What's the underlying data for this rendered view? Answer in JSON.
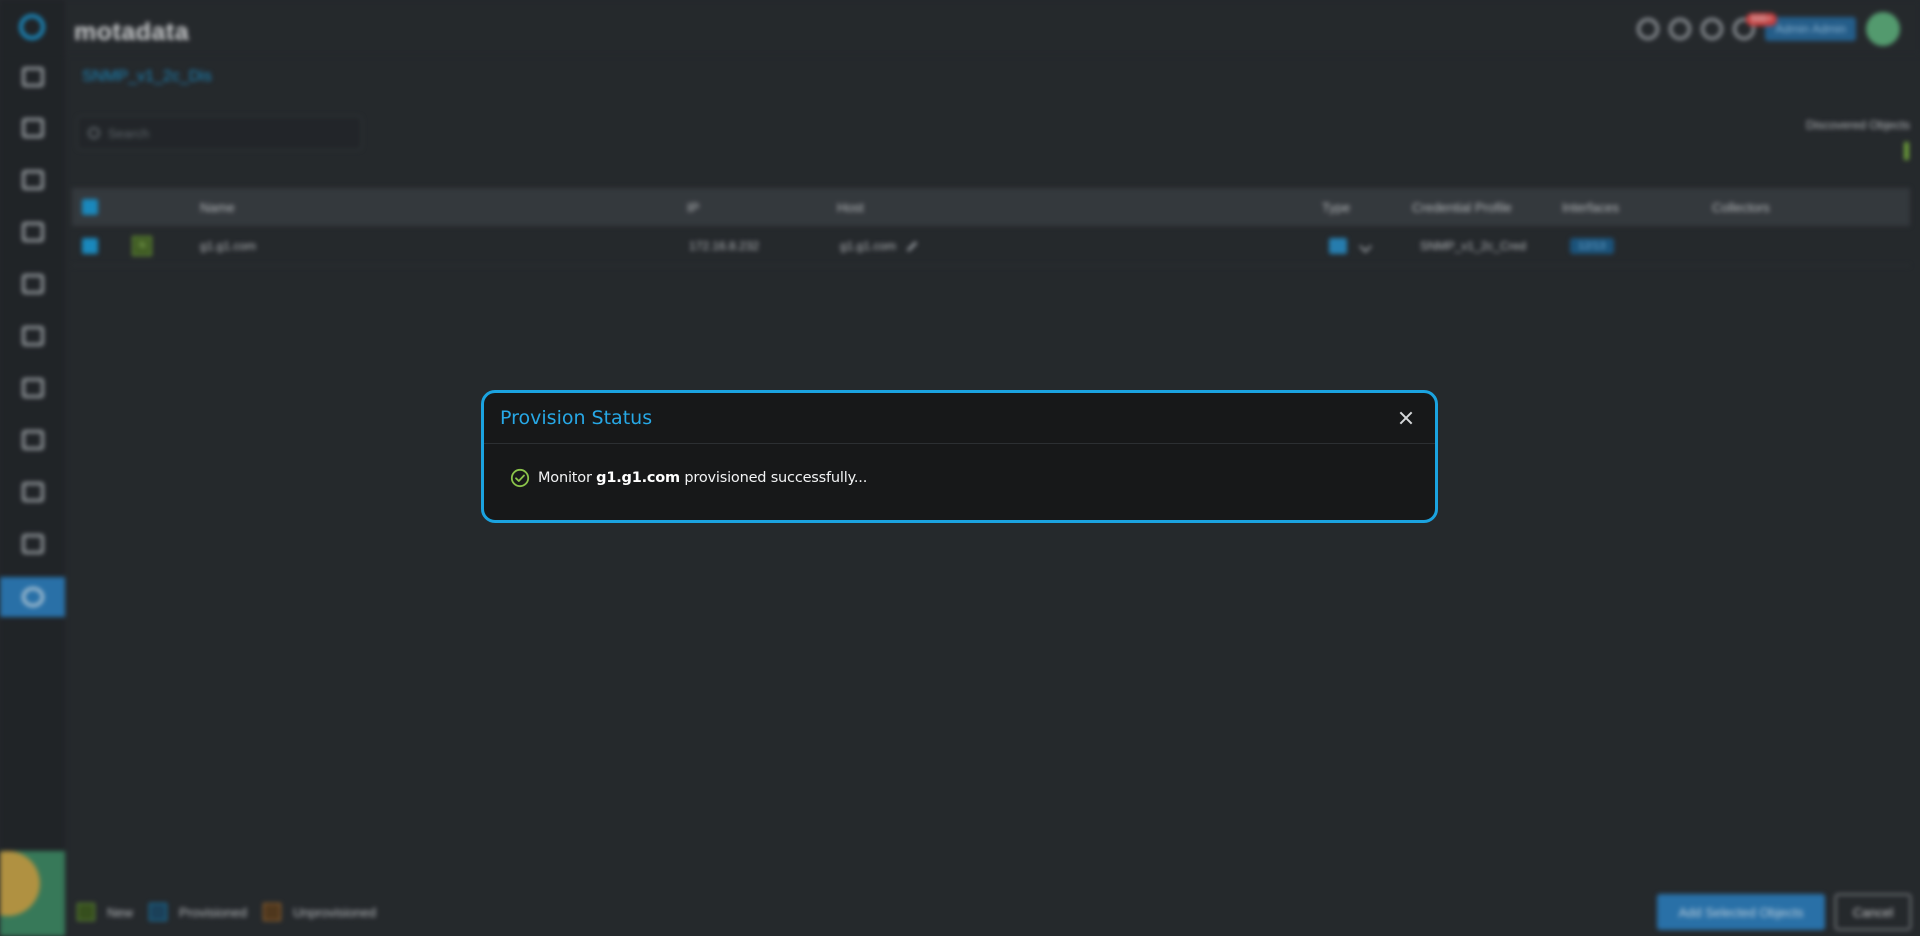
{
  "app": {
    "brand": "motadata"
  },
  "header": {
    "notification_badge": "999+",
    "user_label": "Admin Admin"
  },
  "page": {
    "title": "SNMP_v1_2c_Dis",
    "search_placeholder": "Search",
    "discovered_objects_label": "Discovered Objects"
  },
  "table": {
    "columns": [
      "Name",
      "IP",
      "Host",
      "Type",
      "Credential Profile",
      "Interfaces",
      "Collectors"
    ],
    "rows": [
      {
        "status_tag": "N",
        "name": "g1.g1.com",
        "ip": "172.16.8.232",
        "host": "g1.g1.com",
        "credential_profile": "SNMP_v1_2c_Cred",
        "interfaces": "12/13",
        "collectors": ""
      }
    ]
  },
  "legend": {
    "new": "New",
    "provisioned": "Provisioned",
    "unprovisioned": "Unprovisioned"
  },
  "actions": {
    "add_selected": "Add Selected Objects",
    "cancel": "Cancel"
  },
  "modal": {
    "title": "Provision Status",
    "message_prefix": "Monitor",
    "message_host": "g1.g1.com",
    "message_suffix": "provisioned successfully..."
  },
  "colors": {
    "accent": "#1ba3e0",
    "success": "#8bc34a",
    "modal_bg": "#171819",
    "app_bg": "#2b2f33"
  },
  "icons": {
    "sidebar": [
      "dashboard-icon",
      "monitor-icon",
      "metrics-icon",
      "log-icon",
      "network-icon",
      "alert-icon",
      "topology-icon",
      "apm-icon",
      "report-icon",
      "document-icon",
      "settings-icon"
    ],
    "modal_status": "check-circle-icon"
  }
}
